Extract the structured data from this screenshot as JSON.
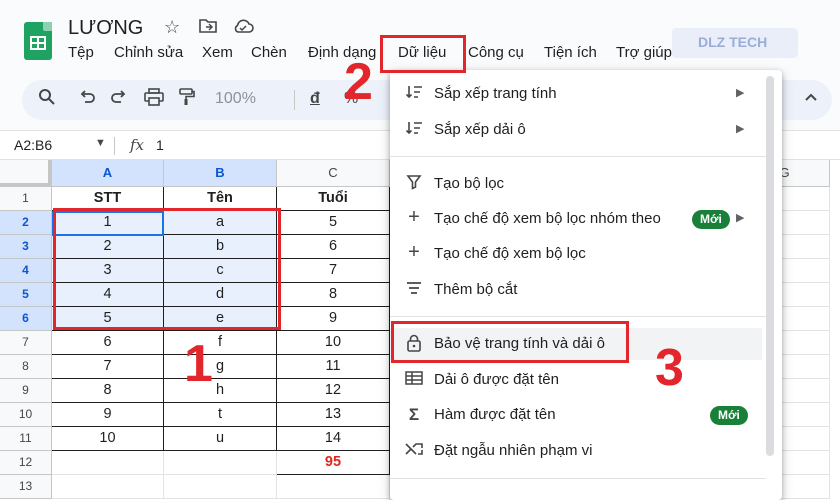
{
  "app": {
    "title": "LƯƠNG",
    "star_icon": "star-icon",
    "folder_icon": "folder-move-icon",
    "cloud_icon": "cloud-status-icon"
  },
  "menu": [
    "Tệp",
    "Chỉnh sửa",
    "Xem",
    "Chèn",
    "Định dạng",
    "Dữ liệu",
    "Công cụ",
    "Tiện ích",
    "Trợ giúp"
  ],
  "watermark": "DLZ TECH",
  "toolbar": {
    "zoom": "100%",
    "currency": "đ",
    "percent": "%",
    "icons": [
      "search-icon",
      "undo-icon",
      "redo-icon",
      "print-icon",
      "paint-format-icon",
      "chevron-up-icon"
    ]
  },
  "formula_bar": {
    "namebox": "A2:B6",
    "value": "1"
  },
  "columns": [
    "A",
    "B",
    "C",
    "G"
  ],
  "rows": [
    "1",
    "2",
    "3",
    "4",
    "5",
    "6",
    "7",
    "8",
    "9",
    "10",
    "11",
    "12",
    "13"
  ],
  "table": {
    "headers": [
      "STT",
      "Tên",
      "Tuổi"
    ],
    "data": [
      [
        "1",
        "a",
        "5"
      ],
      [
        "2",
        "b",
        "6"
      ],
      [
        "3",
        "c",
        "7"
      ],
      [
        "4",
        "d",
        "8"
      ],
      [
        "5",
        "e",
        "9"
      ],
      [
        "6",
        "f",
        "10"
      ],
      [
        "7",
        "g",
        "11"
      ],
      [
        "8",
        "h",
        "12"
      ],
      [
        "9",
        "t",
        "13"
      ],
      [
        "10",
        "u",
        "14"
      ]
    ],
    "total": "95"
  },
  "dropdown": {
    "items": [
      {
        "label": "Sắp xếp trang tính",
        "icon": "sort-icon",
        "submenu": true
      },
      {
        "label": "Sắp xếp dải ô",
        "icon": "sort-range-icon",
        "submenu": true
      },
      {
        "label": "Tạo bộ lọc",
        "icon": "filter-icon"
      },
      {
        "label": "Tạo chế độ xem bộ lọc nhóm theo",
        "icon": "plus-icon",
        "badge": "Mới",
        "submenu": true
      },
      {
        "label": "Tạo chế độ xem bộ lọc",
        "icon": "plus-icon"
      },
      {
        "label": "Thêm bộ cắt",
        "icon": "slicer-icon"
      },
      {
        "label": "Bảo vệ trang tính và dải ô",
        "icon": "lock-icon"
      },
      {
        "label": "Dải ô được đặt tên",
        "icon": "named-range-icon"
      },
      {
        "label": "Hàm được đặt tên",
        "icon": "sigma-icon",
        "badge": "Mới"
      },
      {
        "label": "Đặt ngẫu nhiên phạm vi",
        "icon": "shuffle-icon"
      }
    ]
  },
  "annotations": [
    "1",
    "2",
    "3"
  ],
  "colors": {
    "annotation": "#e2262c",
    "selection": "#d3e3fd",
    "badge": "#188038",
    "sheets_green": "#1ea362"
  }
}
